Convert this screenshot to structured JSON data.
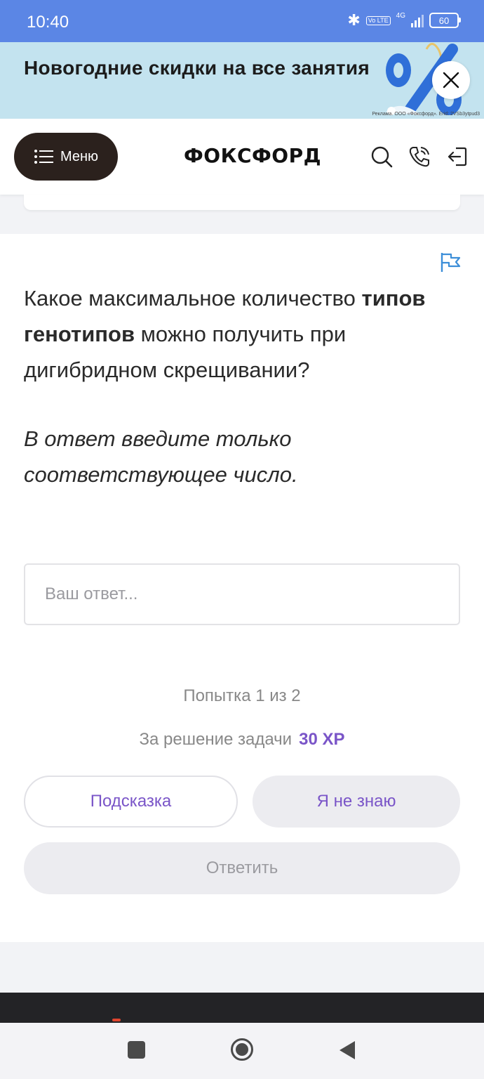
{
  "status_bar": {
    "time": "10:40",
    "volte": "Vo LTE",
    "network": "4G",
    "battery": "60"
  },
  "promo": {
    "text": "Новогодние скидки на все занятия",
    "legal": "Реклама. ООО «Фоксфорд». Erid: 2VSb3ytpud3"
  },
  "header": {
    "menu_label": "Меню",
    "logo": "ФОКСФОРД"
  },
  "task": {
    "question_part1": "Какое максимальное количество ",
    "question_bold1": "типов генотипов",
    "question_part2": " можно получить при дигибридном скрещивании?",
    "instruction": "В ответ введите только соответствующее число.",
    "answer_placeholder": "Ваш ответ...",
    "answer_value": "",
    "attempts": "Попытка 1 из 2",
    "reward_label": "За решение задачи",
    "reward_xp": "30 XP",
    "hint_button": "Подсказка",
    "dont_know_button": "Я не знаю",
    "submit_button": "Ответить"
  },
  "colors": {
    "status_bar": "#5b86e5",
    "promo_bg": "#c3e3ef",
    "accent": "#7a55c8",
    "menu_button": "#2b211d"
  },
  "icons": {
    "header": [
      "search-icon",
      "phone-icon",
      "login-icon"
    ],
    "task": [
      "report-flag-icon"
    ],
    "nav": [
      "recent-apps-icon",
      "home-icon",
      "back-icon"
    ]
  }
}
